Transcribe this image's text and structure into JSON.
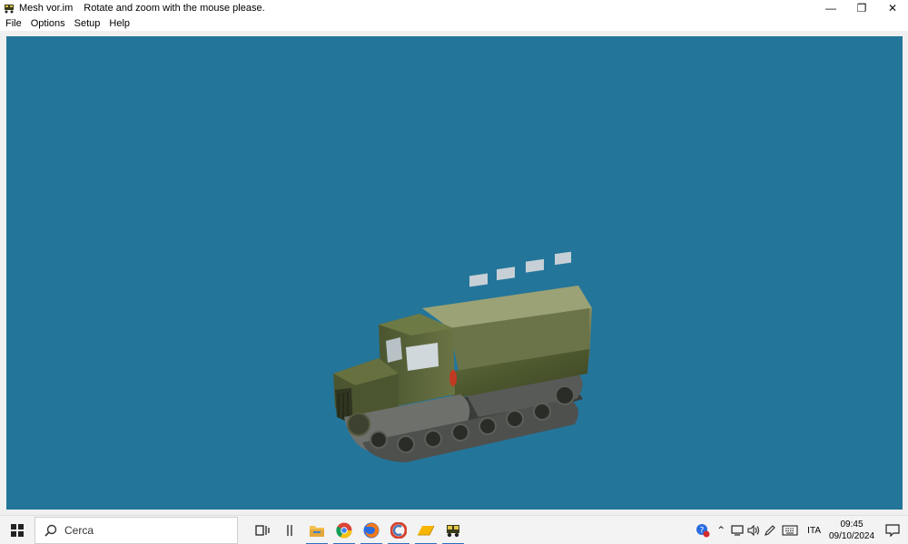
{
  "window": {
    "app_title": "Mesh vor.im",
    "message": "Rotate and zoom with the mouse please.",
    "controls": {
      "minimize": "—",
      "restore": "❐",
      "close": "✕"
    }
  },
  "menu": {
    "items": [
      {
        "label": "File"
      },
      {
        "label": "Options"
      },
      {
        "label": "Setup"
      },
      {
        "label": "Help"
      }
    ]
  },
  "viewport": {
    "background_color": "#24759a",
    "model": "tracked-truck"
  },
  "taskbar": {
    "search_placeholder": "Cerca",
    "pinned": [
      {
        "name": "task-view-icon"
      },
      {
        "name": "separator"
      },
      {
        "name": "file-explorer-icon"
      },
      {
        "name": "chrome-icon"
      },
      {
        "name": "firefox-icon"
      },
      {
        "name": "ccleaner-icon"
      },
      {
        "name": "folder-drive-icon"
      },
      {
        "name": "mesh-viewer-icon"
      }
    ],
    "tray": {
      "language": "ITA",
      "time": "09:45",
      "date": "09/10/2024"
    }
  }
}
